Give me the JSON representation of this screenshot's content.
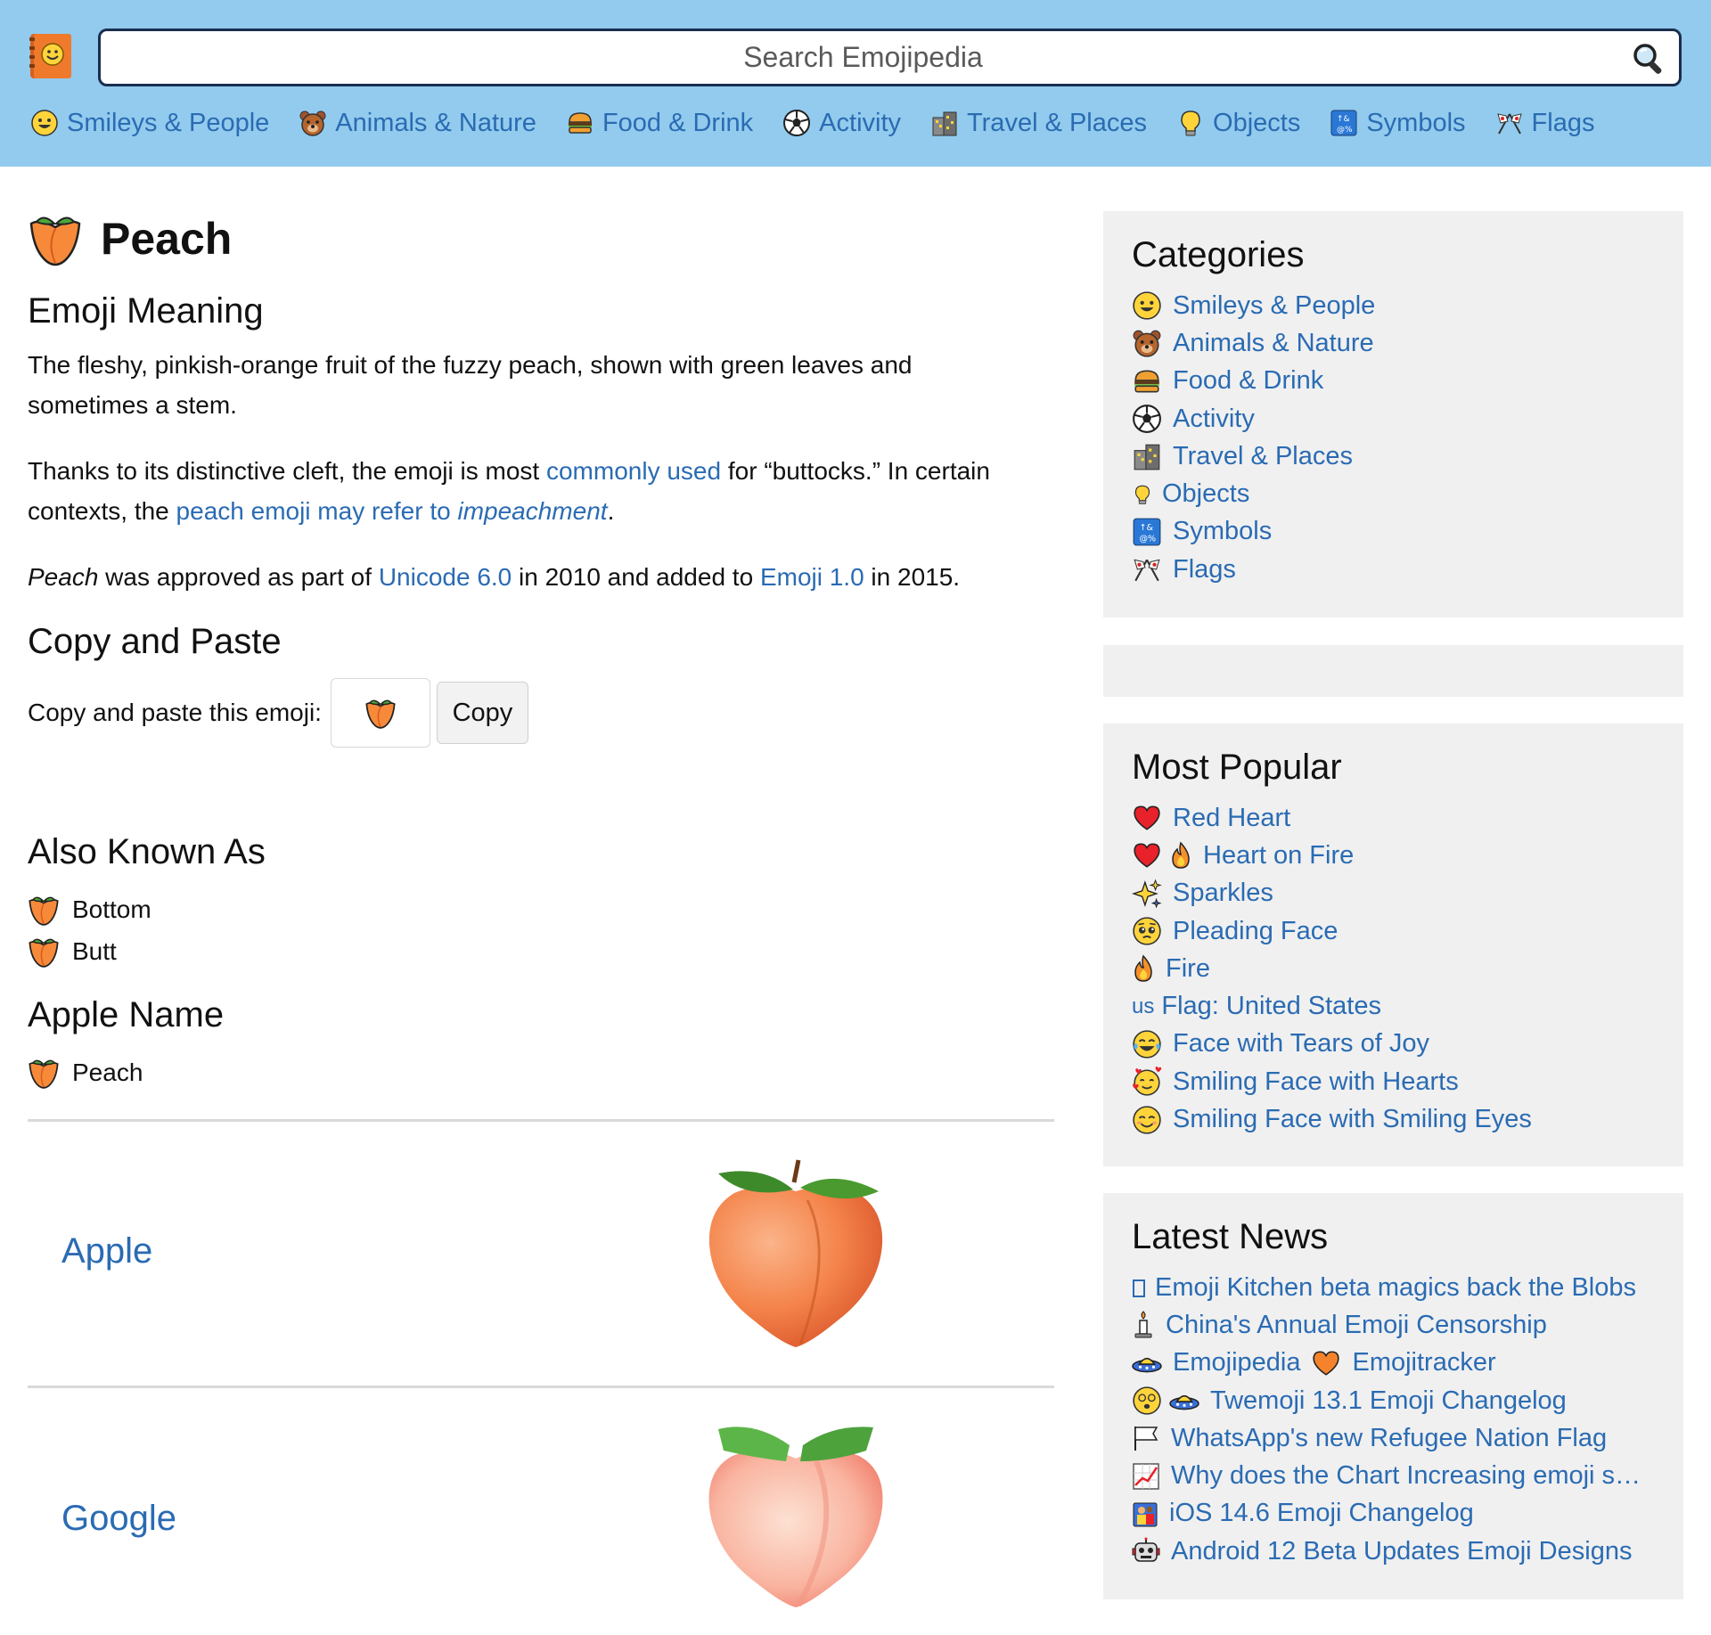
{
  "header": {
    "search_placeholder": "Search Emojipedia",
    "nav": [
      {
        "label": "Smileys & People",
        "icon": "grinning-face-icon"
      },
      {
        "label": "Animals & Nature",
        "icon": "bear-face-icon"
      },
      {
        "label": "Food & Drink",
        "icon": "hamburger-icon"
      },
      {
        "label": "Activity",
        "icon": "soccer-ball-icon"
      },
      {
        "label": "Travel & Places",
        "icon": "buildings-icon"
      },
      {
        "label": "Objects",
        "icon": "light-bulb-icon"
      },
      {
        "label": "Symbols",
        "icon": "symbols-icon"
      },
      {
        "label": "Flags",
        "icon": "crossed-flags-icon"
      }
    ]
  },
  "main": {
    "title": "Peach",
    "meaning_heading": "Emoji Meaning",
    "meaning_p1": "The fleshy, pinkish-orange fruit of the fuzzy peach, shown with green leaves and sometimes a stem.",
    "meaning_p2": {
      "t1": "Thanks to its distinctive cleft, the emoji is most ",
      "link1": "commonly used",
      "t2": " for “buttocks.” In certain contexts, the ",
      "link2": "peach emoji may refer to ",
      "link2_em": "impeachment",
      "t3": "."
    },
    "meaning_p3": {
      "em": "Peach",
      "t1": " was approved as part of ",
      "link1": "Unicode 6.0",
      "t2": " in 2010 and added to ",
      "link2": "Emoji 1.0",
      "t3": " in 2015."
    },
    "copy_heading": "Copy and Paste",
    "copy_label": "Copy and paste this emoji:",
    "copy_value": "🍑",
    "copy_button": "Copy",
    "aka_heading": "Also Known As",
    "aka": [
      "Bottom",
      "Butt"
    ],
    "apple_name_heading": "Apple Name",
    "apple_name": "Peach",
    "vendors": [
      "Apple",
      "Google"
    ]
  },
  "sidebar": {
    "categories_heading": "Categories",
    "categories": [
      {
        "label": "Smileys & People",
        "icon": "grinning-face-icon"
      },
      {
        "label": "Animals & Nature",
        "icon": "bear-face-icon"
      },
      {
        "label": "Food & Drink",
        "icon": "hamburger-icon"
      },
      {
        "label": "Activity",
        "icon": "soccer-ball-icon"
      },
      {
        "label": "Travel & Places",
        "icon": "buildings-icon"
      },
      {
        "label": "Objects",
        "icon": "light-bulb-icon"
      },
      {
        "label": "Symbols",
        "icon": "symbols-icon"
      },
      {
        "label": "Flags",
        "icon": "crossed-flags-icon"
      }
    ],
    "popular_heading": "Most Popular",
    "popular": [
      {
        "label": "Red Heart",
        "icon": "red-heart-icon"
      },
      {
        "label": "Heart on Fire",
        "icon": "heart-on-fire-icon"
      },
      {
        "label": "Sparkles",
        "icon": "sparkles-icon"
      },
      {
        "label": "Pleading Face",
        "icon": "pleading-face-icon"
      },
      {
        "label": "Fire",
        "icon": "fire-icon"
      },
      {
        "label": "Flag: United States",
        "icon": "us-flag-icon",
        "prefix": "us"
      },
      {
        "label": "Face with Tears of Joy",
        "icon": "tears-of-joy-icon"
      },
      {
        "label": "Smiling Face with Hearts",
        "icon": "smiling-face-hearts-icon"
      },
      {
        "label": "Smiling Face with Smiling Eyes",
        "icon": "smiling-eyes-icon"
      }
    ],
    "news_heading": "Latest News",
    "news": [
      {
        "label": "Emoji Kitchen beta magics back the Blobs",
        "icon": "missing-glyph-icon"
      },
      {
        "label": "China's Annual Emoji Censorship",
        "icon": "candle-icon"
      },
      {
        "label": "Emojitracker",
        "pre": "Emojipedia",
        "icon": "flying-saucer-icon"
      },
      {
        "label": "Twemoji 13.1 Emoji Changelog",
        "icon": "face-with-spiral-eyes-icon"
      },
      {
        "label": "WhatsApp's new Refugee Nation Flag",
        "icon": "white-flag-icon"
      },
      {
        "label": "Why does the Chart Increasing emoji s…",
        "icon": "chart-increasing-icon"
      },
      {
        "label": "iOS 14.6 Emoji Changelog",
        "icon": "people-icon"
      },
      {
        "label": "Android 12 Beta Updates Emoji Designs",
        "icon": "robot-icon"
      }
    ]
  },
  "colors": {
    "header_bg": "#92cbed",
    "link": "#2a6bb3",
    "panel_bg": "#f0f0f0",
    "search_border": "#1a2e4f"
  }
}
